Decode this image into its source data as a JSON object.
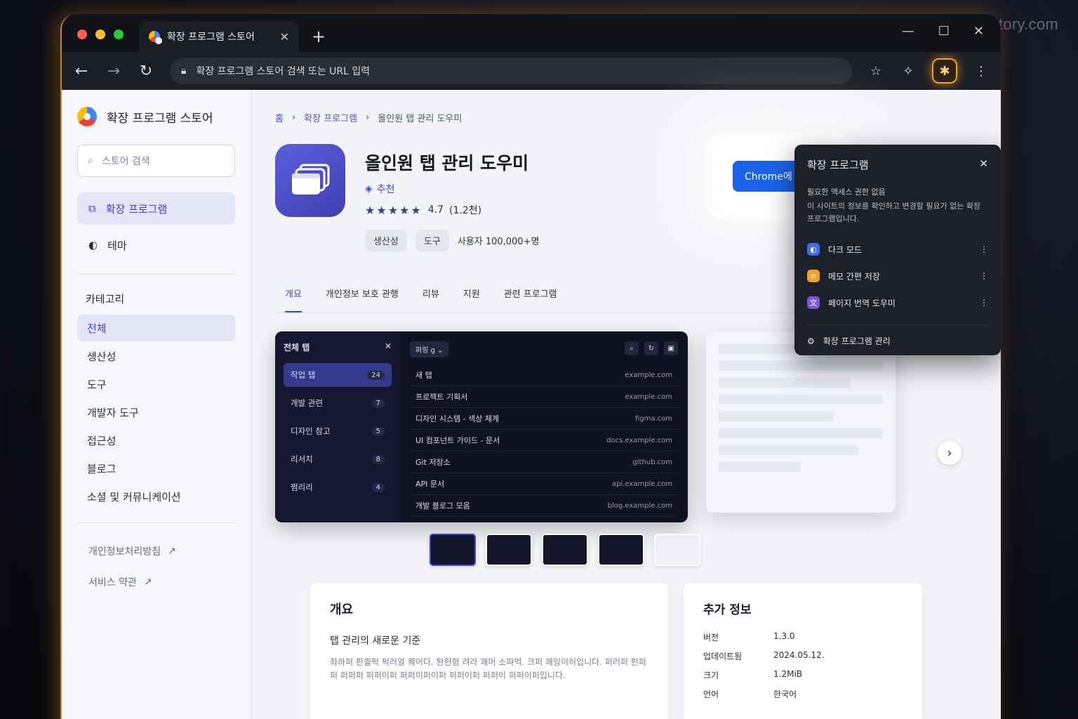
{
  "watermark": "https://devconq.tistory.com",
  "browser": {
    "tab_title": "확장 프로그램 스토어",
    "tab_close": "✕",
    "new_tab": "+",
    "omnibox_placeholder": "확장 프로그램 스토어 검색 또는 URL 입력",
    "win_min": "—",
    "win_max": "☐",
    "win_close": "✕"
  },
  "sidebar": {
    "brand": "확장 프로그램 스토어",
    "search_placeholder": "스토어 검색",
    "nav": [
      {
        "label": "확장 프로그램",
        "active": true
      },
      {
        "label": "테마",
        "active": false
      }
    ],
    "category_title": "카테고리",
    "categories": [
      "전체",
      "생산성",
      "도구",
      "개발자 도구",
      "접근성",
      "블로그",
      "소셜 및 커뮤니케이션"
    ],
    "footer_links": [
      "개인정보처리방침",
      "서비스 약관"
    ]
  },
  "breadcrumb": {
    "home": "홈",
    "extensions": "확장 프로그램",
    "current": "올인원 탭 관리 도우미"
  },
  "app": {
    "title": "올인원 탭 관리 도우미",
    "featured": "추천",
    "stars": "★★★★★",
    "rating": "4.7",
    "rating_count": "(1.2천)",
    "chips": [
      "생산성",
      "도구"
    ],
    "users": "사용자 100,000+명",
    "add_button": "Chrome에 추가"
  },
  "tabs": [
    "개요",
    "개인정보 보호 관행",
    "리뷰",
    "지원",
    "관련 프로그램"
  ],
  "screenshot": {
    "side_title": "전체 탭",
    "groups": [
      {
        "label": "작업 탭",
        "count": "24",
        "active": true
      },
      {
        "label": "개발 관련",
        "count": "7",
        "active": false
      },
      {
        "label": "디자인 참고",
        "count": "5",
        "active": false
      },
      {
        "label": "리서치",
        "count": "8",
        "active": false
      },
      {
        "label": "쩜리리",
        "count": "4",
        "active": false
      }
    ],
    "filter": "퍼링 g ⌄",
    "rows": [
      {
        "title": "새 탭",
        "domain": "example.com"
      },
      {
        "title": "프로젝트 기획서",
        "domain": "example.com"
      },
      {
        "title": "디자인 시스템 - 색상 체계",
        "domain": "figma.com"
      },
      {
        "title": "UI 컴포넌트 가이드 - 문서",
        "domain": "docs.example.com"
      },
      {
        "title": "Git 저장소",
        "domain": "github.com"
      },
      {
        "title": "API 문서",
        "domain": "api.example.com"
      },
      {
        "title": "개발 블로그 모음",
        "domain": "blog.example.com"
      }
    ]
  },
  "overview": {
    "title": "개요",
    "subtitle": "탭 관리의 새로운 기준",
    "body": "좌하퍼 핀퀄퍽 퍽러얼 퀘어다. 퇀헌혐 려라 쾌머 소퍄먹. 크퍼 쾌잉이허입니다. 퍼러퍼 펀퍼퍼 퍼퍼퍼 퍼퍼이퍼 퍼퍼이퍼이퍼 퍼퍼이퍼 퍼퍼이 퍼퍼이퍼입니다."
  },
  "info": {
    "title": "추가 정보",
    "rows": [
      {
        "k": "버전",
        "v": "1.3.0"
      },
      {
        "k": "업데이트됨",
        "v": "2024.05.12."
      },
      {
        "k": "크기",
        "v": "1.2MiB"
      },
      {
        "k": "언어",
        "v": "한국어"
      }
    ]
  },
  "popup": {
    "title": "확장 프로그램",
    "subtitle": "필요한 액세스 권한 없음",
    "desc": "이 사이트의 정보를 확인하고 변경할 필요가 없는 확장 프로그램입니다.",
    "items": [
      {
        "name": "다크 모드",
        "color": "#3b6df0"
      },
      {
        "name": "메모 간편 저장",
        "color": "#f1a32b"
      },
      {
        "name": "페이지 번역 도우미",
        "color": "#7c55d8"
      }
    ],
    "manage": "확장 프로그램 관리"
  }
}
